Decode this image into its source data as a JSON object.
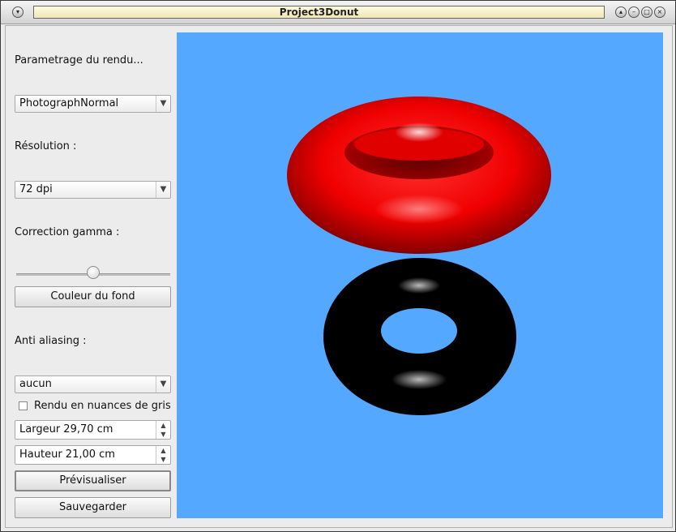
{
  "window": {
    "title": "Project3Donut"
  },
  "sidebar": {
    "render_settings_label": "Parametrage du rendu...",
    "render_mode_value": "PhotographNormal",
    "resolution_label": "Résolution :",
    "resolution_value": "72 dpi",
    "gamma_label": "Correction gamma :",
    "gamma_level": 0.5,
    "background_color_button": "Couleur du fond",
    "antialias_label": "Anti aliasing :",
    "antialias_value": "aucun",
    "grayscale_label": "Rendu en nuances de gris",
    "grayscale_checked": false,
    "width_value": "Largeur 29,70 cm",
    "height_value": "Hauteur 21,00 cm",
    "preview_button": "Prévisualiser",
    "save_button": "Sauvegarder"
  },
  "preview": {
    "background_color": "#54a8ff",
    "donut_top_color": "#ff1a1a",
    "donut_bottom_color": "#000000"
  }
}
